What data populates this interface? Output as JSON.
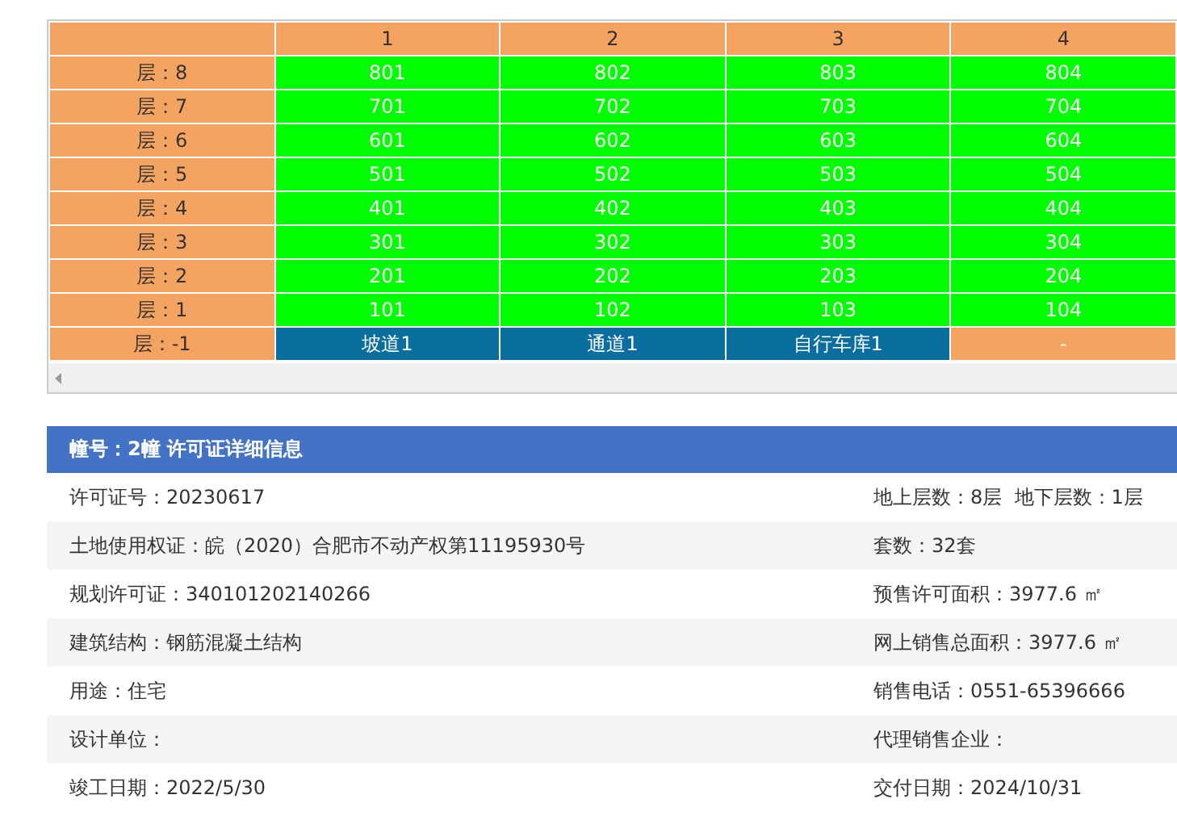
{
  "unit_table": {
    "columns": [
      "1",
      "2",
      "3",
      "4"
    ],
    "rows": [
      {
        "floor": "层：8",
        "cells": [
          {
            "text": "801",
            "kind": "unit"
          },
          {
            "text": "802",
            "kind": "unit"
          },
          {
            "text": "803",
            "kind": "unit"
          },
          {
            "text": "804",
            "kind": "unit"
          }
        ]
      },
      {
        "floor": "层：7",
        "cells": [
          {
            "text": "701",
            "kind": "unit"
          },
          {
            "text": "702",
            "kind": "unit"
          },
          {
            "text": "703",
            "kind": "unit"
          },
          {
            "text": "704",
            "kind": "unit"
          }
        ]
      },
      {
        "floor": "层：6",
        "cells": [
          {
            "text": "601",
            "kind": "unit"
          },
          {
            "text": "602",
            "kind": "unit"
          },
          {
            "text": "603",
            "kind": "unit"
          },
          {
            "text": "604",
            "kind": "unit"
          }
        ]
      },
      {
        "floor": "层：5",
        "cells": [
          {
            "text": "501",
            "kind": "unit"
          },
          {
            "text": "502",
            "kind": "unit"
          },
          {
            "text": "503",
            "kind": "unit"
          },
          {
            "text": "504",
            "kind": "unit"
          }
        ]
      },
      {
        "floor": "层：4",
        "cells": [
          {
            "text": "401",
            "kind": "unit"
          },
          {
            "text": "402",
            "kind": "unit"
          },
          {
            "text": "403",
            "kind": "unit"
          },
          {
            "text": "404",
            "kind": "unit"
          }
        ]
      },
      {
        "floor": "层：3",
        "cells": [
          {
            "text": "301",
            "kind": "unit"
          },
          {
            "text": "302",
            "kind": "unit"
          },
          {
            "text": "303",
            "kind": "unit"
          },
          {
            "text": "304",
            "kind": "unit"
          }
        ]
      },
      {
        "floor": "层：2",
        "cells": [
          {
            "text": "201",
            "kind": "unit"
          },
          {
            "text": "202",
            "kind": "unit"
          },
          {
            "text": "203",
            "kind": "unit"
          },
          {
            "text": "204",
            "kind": "unit"
          }
        ]
      },
      {
        "floor": "层：1",
        "cells": [
          {
            "text": "101",
            "kind": "unit"
          },
          {
            "text": "102",
            "kind": "unit"
          },
          {
            "text": "103",
            "kind": "unit"
          },
          {
            "text": "104",
            "kind": "unit"
          }
        ]
      },
      {
        "floor": "层：-1",
        "cells": [
          {
            "text": "坡道1",
            "kind": "facility"
          },
          {
            "text": "通道1",
            "kind": "facility"
          },
          {
            "text": "自行车库1",
            "kind": "facility"
          },
          {
            "text": "-",
            "kind": "empty"
          }
        ]
      }
    ]
  },
  "permit": {
    "title": "幢号：2幢 许可证详细信息",
    "rows": [
      {
        "left": "许可证号：20230617",
        "right": "地上层数：8层  地下层数：1层"
      },
      {
        "left": "土地使用权证：皖（2020）合肥市不动产权第11195930号",
        "right": "套数：32套"
      },
      {
        "left": "规划许可证：340101202140266",
        "right": "预售许可面积：3977.6 ㎡"
      },
      {
        "left": "建筑结构：钢筋混凝土结构",
        "right": "网上销售总面积：3977.6 ㎡"
      },
      {
        "left": "用途：住宅",
        "right": "销售电话：0551-65396666"
      },
      {
        "left": "设计单位：",
        "right": "代理销售企业："
      },
      {
        "left": "竣工日期：2022/5/30",
        "right": "交付日期：2024/10/31"
      }
    ]
  }
}
